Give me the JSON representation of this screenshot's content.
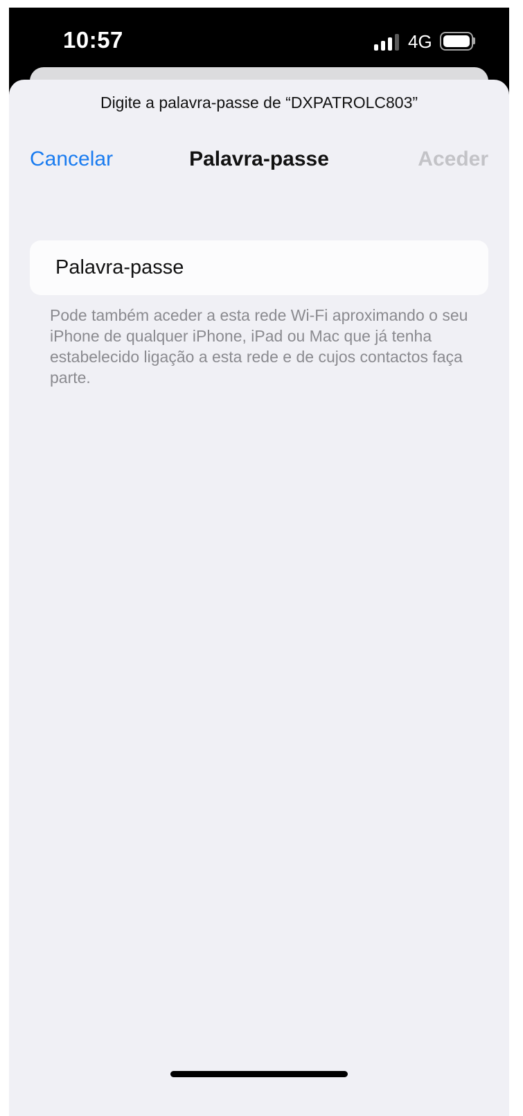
{
  "status_bar": {
    "time": "10:57",
    "network_type": "4G",
    "signal_bars_active": 3,
    "signal_bars_total": 4,
    "battery_level": 1.0
  },
  "sheet": {
    "prompt": "Digite a palavra-passe de “DXPATROLC803”",
    "nav": {
      "cancel_label": "Cancelar",
      "title": "Palavra-passe",
      "join_label": "Aceder"
    },
    "password_field": {
      "placeholder": "Palavra-passe",
      "value": ""
    },
    "footer_note": "Pode também aceder a esta rede Wi-Fi aproximando o seu iPhone de qualquer iPhone, iPad ou Mac que já tenha estabelecido ligação a esta rede e de cujos contactos faça parte."
  },
  "colors": {
    "accent": "#1a7cf0",
    "disabled": "#c3c3c7",
    "sheet_background": "#f0f0f5",
    "secondary_text": "#8a8a8f"
  },
  "icons": {
    "signal": "cellular-signal-icon",
    "battery": "battery-icon"
  }
}
